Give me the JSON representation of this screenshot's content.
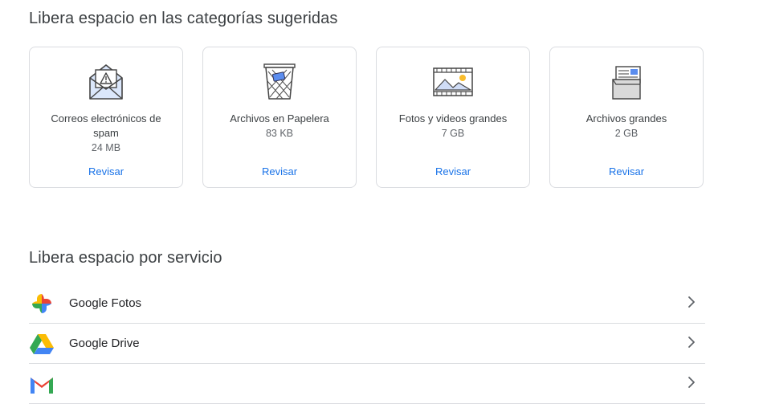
{
  "sections": {
    "suggested_title": "Libera espacio en las categorías sugeridas",
    "service_title": "Libera espacio por servicio"
  },
  "cards": [
    {
      "icon": "spam-envelope-icon",
      "name": "Correos electrónicos de spam",
      "size": "24 MB",
      "action": "Revisar"
    },
    {
      "icon": "trash-bin-icon",
      "name": "Archivos en Papelera",
      "size": "83 KB",
      "action": "Revisar"
    },
    {
      "icon": "photo-film-icon",
      "name": "Fotos y videos grandes",
      "size": "7 GB",
      "action": "Revisar"
    },
    {
      "icon": "large-file-icon",
      "name": "Archivos grandes",
      "size": "2 GB",
      "action": "Revisar"
    }
  ],
  "services": [
    {
      "icon": "google-photos-icon",
      "label": "Google Fotos"
    },
    {
      "icon": "google-drive-icon",
      "label": "Google Drive"
    },
    {
      "icon": "gmail-icon",
      "label": ""
    }
  ],
  "colors": {
    "accent": "#1a73e8",
    "border": "#dadce0",
    "text": "#3c4043"
  }
}
